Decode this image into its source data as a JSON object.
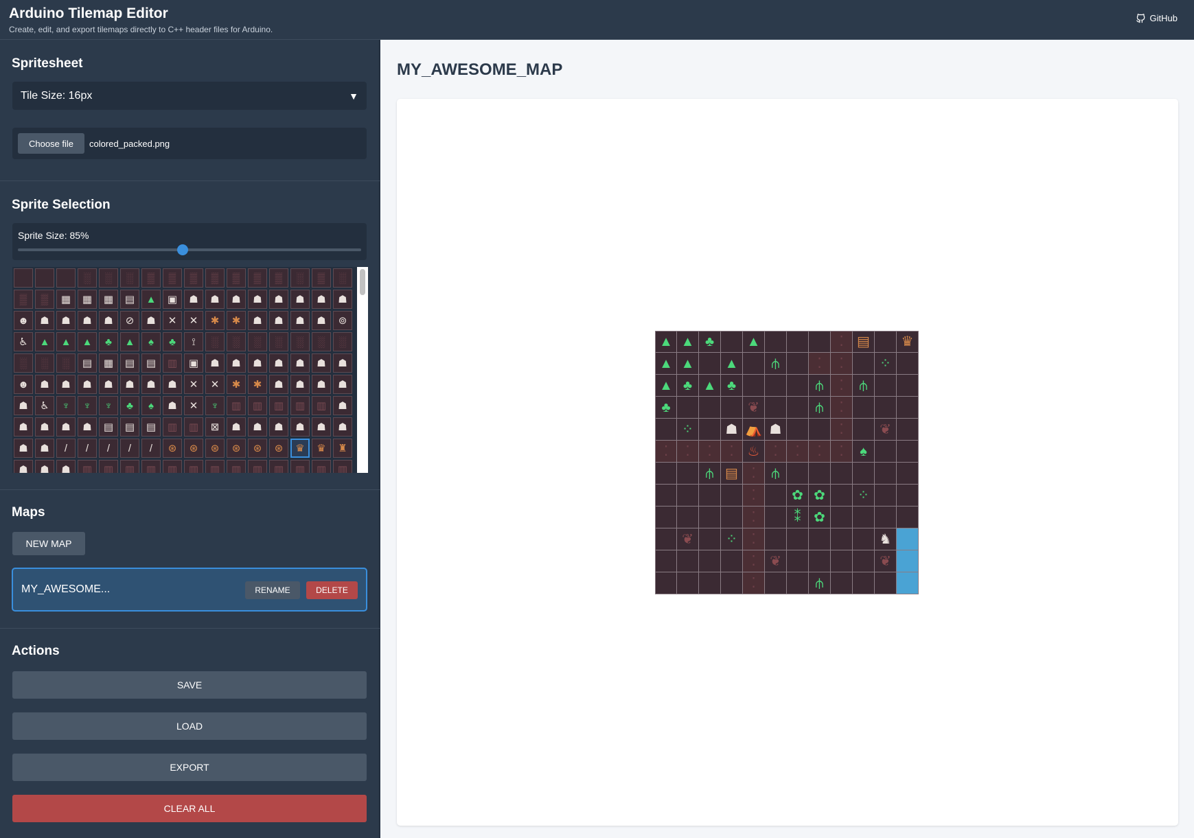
{
  "app": {
    "title": "Arduino Tilemap Editor",
    "subtitle": "Create, edit, and export tilemaps directly to C++ header files for Arduino.",
    "github_label": "GitHub"
  },
  "spritesheet": {
    "title": "Spritesheet",
    "tile_size_label": "Tile Size: 16px",
    "choose_file_label": "Choose file",
    "file_name": "colored_packed.png"
  },
  "sprite_selection": {
    "title": "Sprite Selection",
    "size_label": "Sprite Size: 85%",
    "size_value": 0.48,
    "selected_index": 141,
    "palette_rows": [
      "   ░░░▒▒▒▒▒▒▒░▒░░▒▒▒▒▒░  ",
      "▒▒▦▦▦▤▲▣☗☗☗☗☗☗☗☗",
      "☻☗☗☗☗⊘☗✕✕✱✱☗☗☗☗⊚",
      "♿▲▲▲♣▲♠♣⟟░░░░░░░",
      "░░░▤▦▤▤▥▣☗☗☗☗☗☗☗",
      "☻☗☗☗☗☗☗☗✕✕✱✱☗☗☗☗",
      "☗♿♆♆♆♣♠☗✕♆▥▥▥▥▥☗",
      "☗☗☗☗▤▤▤▥▥⊠☗☗☗☗☗☗",
      "☗☗/////⊛⊛⊛⊛⊛⊛♛♛♜",
      "☗☗☗▥▥▥▥▥▥▥▥▥▥▥▥▥"
    ]
  },
  "maps": {
    "title": "Maps",
    "new_map_label": "NEW MAP",
    "items": [
      {
        "name": "MY_AWESOME...",
        "rename_label": "RENAME",
        "delete_label": "DELETE"
      }
    ]
  },
  "actions": {
    "title": "Actions",
    "save_label": "SAVE",
    "load_label": "LOAD",
    "export_label": "EXPORT",
    "clear_label": "CLEAR ALL"
  },
  "editor": {
    "map_title": "MY_AWESOME_MAP",
    "columns": 12,
    "rows": 12,
    "tiles": [
      [
        "tree",
        "tree",
        "trees",
        "",
        "tree",
        "",
        "",
        "",
        "brick",
        "sign",
        "",
        "crown"
      ],
      [
        "tree",
        "tree",
        "",
        "tree",
        "",
        "grass",
        "",
        "brick",
        "brick",
        "",
        "sprout",
        ""
      ],
      [
        "tree",
        "trees",
        "tree",
        "trees",
        "",
        "",
        "",
        "grass",
        "brick",
        "grass",
        "",
        ""
      ],
      [
        "trees",
        "",
        "",
        "",
        "weed",
        "",
        "",
        "grass",
        "brick",
        "",
        "",
        ""
      ],
      [
        "",
        "sprout",
        "",
        "skeleton",
        "tent",
        "skeleton",
        "",
        "",
        "brick",
        "",
        "weed",
        ""
      ],
      [
        "brick",
        "brick",
        "brick",
        "brick",
        "fire",
        "brick",
        "brick",
        "brick",
        "brick",
        "bush",
        "",
        ""
      ],
      [
        "",
        "",
        "grass",
        "sign",
        "brick",
        "grass",
        "",
        "",
        "",
        "",
        "",
        ""
      ],
      [
        "",
        "",
        "",
        "",
        "brick",
        "",
        "flowers",
        "flowers",
        "",
        "sprout",
        "",
        ""
      ],
      [
        "",
        "",
        "",
        "",
        "brick",
        "",
        "sprouts",
        "flowers",
        "",
        "",
        "",
        ""
      ],
      [
        "",
        "weed",
        "",
        "sprout",
        "brick",
        "",
        "",
        "",
        "",
        "",
        "cat",
        "water"
      ],
      [
        "",
        "",
        "",
        "",
        "brick",
        "weed",
        "",
        "",
        "",
        "",
        "weed",
        "water"
      ],
      [
        "",
        "",
        "",
        "",
        "brick",
        "",
        "",
        "grass",
        "",
        "",
        "",
        "water"
      ]
    ],
    "tile_glyphs": {
      "tree": "▲",
      "trees": "♣",
      "grass": "⫛",
      "sprout": "⁘",
      "sprouts": "⁑",
      "flowers": "✿",
      "weed": "❦",
      "sign": "▤",
      "crown": "♛",
      "skeleton": "☗",
      "tent": "⛺",
      "fire": "♨",
      "bush": "♠",
      "cat": "♞",
      "brick": "⁚",
      "water": ""
    },
    "tile_colors": {
      "tree": "#4cd97b",
      "trees": "#4cd97b",
      "grass": "#4cd97b",
      "sprout": "#4cd97b",
      "sprouts": "#4cd97b",
      "flowers": "#4cd97b",
      "bush": "#4cd97b",
      "weed": "#8a4b50",
      "sign": "#d88a4a",
      "crown": "#d88a4a",
      "tent": "#d88a4a",
      "fire": "#e85a3a",
      "skeleton": "#e8e0dc",
      "cat": "#e8e0dc",
      "brick": "#6e4048",
      "water": "#4aa3d4"
    }
  },
  "colors": {
    "accent": "#3a8fdd",
    "danger": "#b34848",
    "panel": "#2c3a4b",
    "tile_bg": "#3b2a33"
  }
}
